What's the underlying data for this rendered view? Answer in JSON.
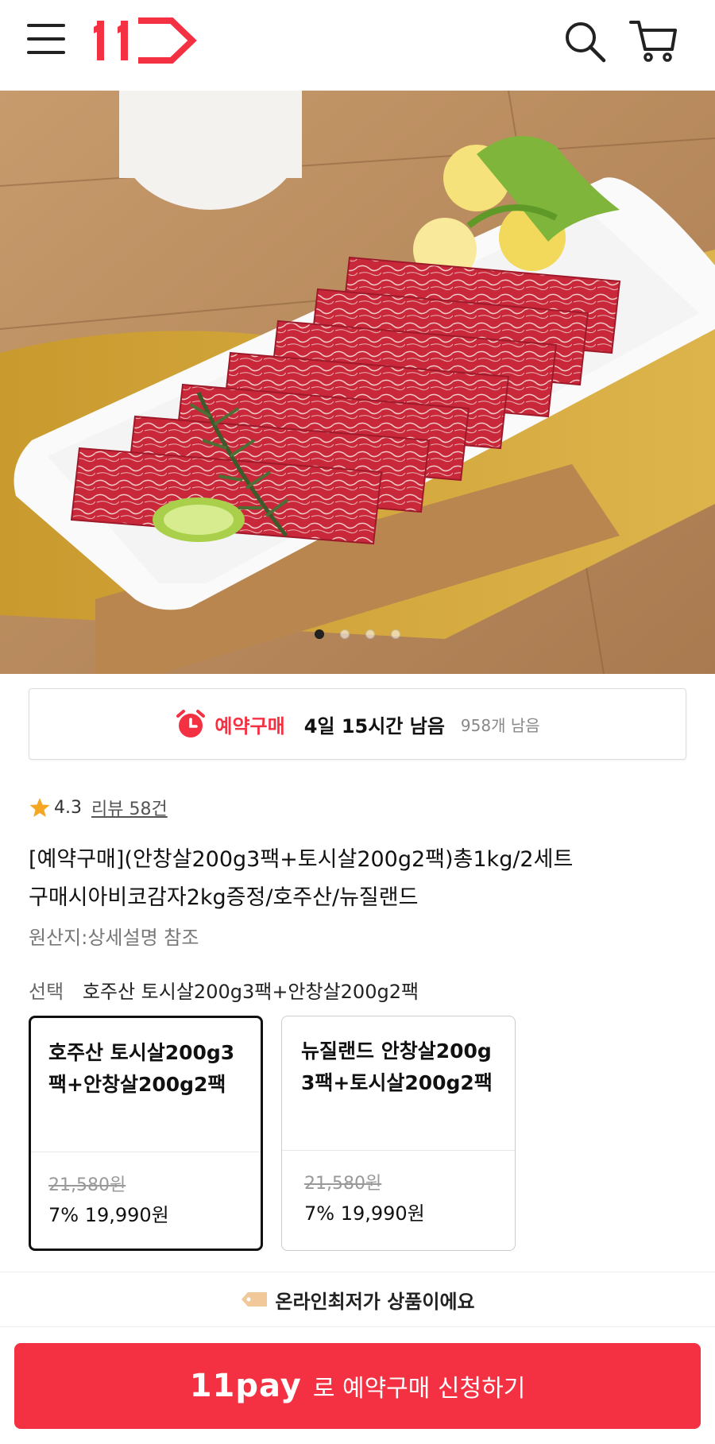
{
  "header": {
    "logo_text": "11",
    "menu_icon": "hamburger-menu-icon",
    "search_icon": "search-icon",
    "cart_icon": "cart-icon",
    "brand_color": "#f43142"
  },
  "hero": {
    "image_alt": "Sliced marbled beef on white plate",
    "carousel_total": 4,
    "carousel_active": 1
  },
  "reservation": {
    "label": "예약구매",
    "time_left": "4일 15시간 남음",
    "stock_left": "958개 남음"
  },
  "rating": {
    "score": "4.3",
    "reviews": "리뷰 58건"
  },
  "product": {
    "title_line1": "[예약구매](안창살200g3팩+토시살200g2팩)총1kg/2세트",
    "title_line2": "구매시아비코감자2kg증정/호주산/뉴질랜드",
    "origin": "원산지:상세설명 참조"
  },
  "selection": {
    "label": "선택",
    "value": "호주산 토시살200g3팩+안창살200g2팩"
  },
  "options": [
    {
      "name": "호주산 토시살200g3팩+안창살200g2팩",
      "original_price": "21,580원",
      "price": "7% 19,990원",
      "selected": true
    },
    {
      "name": "뉴질랜드 안창살200g3팩+토시살200g2팩",
      "original_price": "21,580원",
      "price": "7% 19,990원",
      "selected": false
    }
  ],
  "lowest_price": {
    "text": "온라인최저가 상품이에요"
  },
  "cta": {
    "pay_label": "11pay",
    "text": "로 예약구매 신청하기",
    "color": "#f43142"
  }
}
